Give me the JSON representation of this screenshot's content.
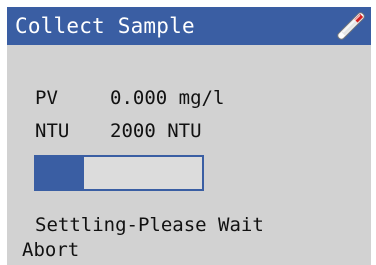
{
  "header": {
    "title": "Collect Sample",
    "icon": "sample-probe-icon",
    "accent_color": "#3a5ea3"
  },
  "readings": [
    {
      "label": "PV",
      "value": "0.000 mg/l"
    },
    {
      "label": "NTU",
      "value": "2000 NTU"
    }
  ],
  "progress": {
    "fraction": 0.29
  },
  "status": {
    "message": "Settling-Please Wait"
  },
  "actions": {
    "abort_label": "Abort"
  }
}
